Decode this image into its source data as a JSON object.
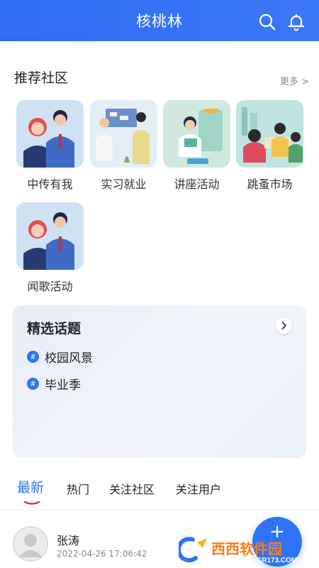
{
  "header": {
    "title": "核桃林",
    "search_icon": "search-icon",
    "notification_icon": "bell-icon"
  },
  "recommended": {
    "title": "推荐社区",
    "more": "更多 >",
    "items": [
      {
        "label": "中传有我"
      },
      {
        "label": "实习就业"
      },
      {
        "label": "讲座活动"
      },
      {
        "label": "跳蚤市场"
      },
      {
        "label": "闻歌活动"
      }
    ]
  },
  "topics": {
    "title": "精选话题",
    "items": [
      {
        "label": "校园风景"
      },
      {
        "label": "毕业季"
      }
    ]
  },
  "tabs": [
    {
      "label": "最新",
      "active": true
    },
    {
      "label": "热门"
    },
    {
      "label": "关注社区"
    },
    {
      "label": "关注用户"
    }
  ],
  "post": {
    "author": "张涛",
    "time": "2022-04-26 17:06:42"
  },
  "fab_label": "+",
  "watermark": {
    "main": "西西软件园",
    "sub": "CR173.COM"
  },
  "colors": {
    "primary": "#2f74f6",
    "tab_indicator": "#d9232f",
    "text": "#222222",
    "muted": "#888888"
  }
}
